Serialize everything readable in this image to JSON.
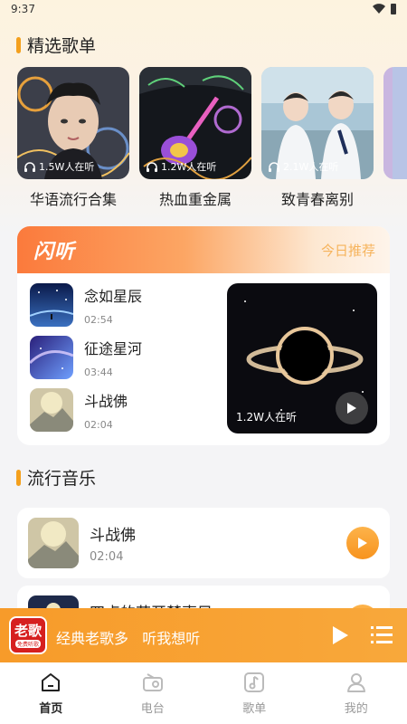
{
  "status_bar": {
    "time": "9:37"
  },
  "sections": {
    "featured": "精选歌单",
    "pop": "流行音乐"
  },
  "playlists": [
    {
      "name": "华语流行合集",
      "listeners": "1.5W人在听"
    },
    {
      "name": "热血重金属",
      "listeners": "1.2W人在听"
    },
    {
      "name": "致青春离别",
      "listeners": "2.1W人在听"
    }
  ],
  "flash": {
    "title": "闪听",
    "recommend": "今日推荐",
    "items": [
      {
        "name": "念如星辰",
        "duration": "02:54"
      },
      {
        "name": "征途星河",
        "duration": "03:44"
      },
      {
        "name": "斗战佛",
        "duration": "02:04"
      }
    ],
    "featured_listeners": "1.2W人在听"
  },
  "pop_songs": [
    {
      "name": "斗战佛",
      "duration": "02:04"
    },
    {
      "name": "四点的花开楚声目",
      "duration": ""
    }
  ],
  "mini_player": {
    "logo_main": "老歌",
    "logo_sub": "免费听歌",
    "text": "经典老歌多   听我想听"
  },
  "nav": [
    {
      "label": "首页",
      "icon": "home-icon",
      "active": true
    },
    {
      "label": "电台",
      "icon": "radio-icon",
      "active": false
    },
    {
      "label": "歌单",
      "icon": "music-note-icon",
      "active": false
    },
    {
      "label": "我的",
      "icon": "user-icon",
      "active": false
    }
  ],
  "colors": {
    "accent": "#f7931e",
    "flash_head": "#fb7a3c"
  }
}
